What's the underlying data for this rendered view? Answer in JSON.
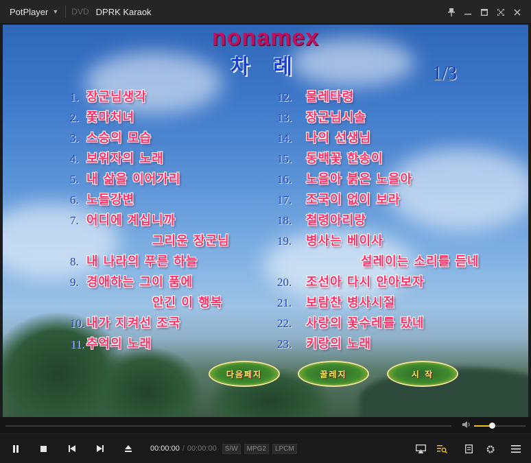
{
  "app": {
    "name": "PotPlayer",
    "source": "DVD",
    "window_title": "DPRK Karaok"
  },
  "titlebar": {
    "icons": [
      "pin-icon",
      "minimize-icon",
      "maximize-icon",
      "fullscreen-icon",
      "close-icon"
    ]
  },
  "video": {
    "brand": "nonamex",
    "heading": "차 례",
    "page": "1/3",
    "left_items": [
      {
        "num": "1.",
        "title": "장군님생각"
      },
      {
        "num": "2.",
        "title": "쫓마처녀"
      },
      {
        "num": "3.",
        "title": "스승의 모습"
      },
      {
        "num": "4.",
        "title": "보위자의 노래"
      },
      {
        "num": "5.",
        "title": "내 삶을 이어가리"
      },
      {
        "num": "6.",
        "title": "노들강변"
      },
      {
        "num": "7.",
        "title": "어디에 계십니까"
      },
      {
        "num": "",
        "title": "그리운 장군님"
      },
      {
        "num": "8.",
        "title": "내 나라의 푸른 하늘"
      },
      {
        "num": "9.",
        "title": "경애하는 그이 품에"
      },
      {
        "num": "",
        "title": "안긴 이 행복"
      },
      {
        "num": "10.",
        "title": "내가 지켜선 조국"
      },
      {
        "num": "11.",
        "title": "추억의 노래"
      }
    ],
    "right_items": [
      {
        "num": "12.",
        "title": "물레타령"
      },
      {
        "num": "13.",
        "title": "장군님시솔"
      },
      {
        "num": "14.",
        "title": "나의 선생님"
      },
      {
        "num": "15.",
        "title": "동백꽃 한송이"
      },
      {
        "num": "16.",
        "title": "노을아 붉은 노을아"
      },
      {
        "num": "17.",
        "title": "조국이 없이 보라"
      },
      {
        "num": "18.",
        "title": "철령아리랑"
      },
      {
        "num": "19.",
        "title": "병사는 베이사"
      },
      {
        "num": "",
        "title": "설레이는 소리를 듣네"
      },
      {
        "num": "20.",
        "title": "조선아 다시 안아보자"
      },
      {
        "num": "21.",
        "title": "보람찬 병사시절"
      },
      {
        "num": "22.",
        "title": "사랑의 꽃수레를 탔네"
      },
      {
        "num": "23.",
        "title": "키랑의 노래"
      }
    ],
    "menu_buttons": [
      "다음페지",
      "꿀레지",
      "시 작"
    ]
  },
  "seekbar": {
    "progress": 0,
    "volume": 0.35,
    "accent": "#f0c020"
  },
  "controls": {
    "current_time": "00:00:00",
    "total_time": "00:00:00",
    "tags": [
      "S/W",
      "MPG2",
      "LPCM"
    ],
    "left_icons": [
      "pause-icon",
      "stop-icon",
      "previous-icon",
      "next-icon",
      "eject-icon"
    ],
    "right_icons": [
      "screen-cast-icon",
      "playlist-search-icon",
      "document-icon",
      "settings-gear-icon",
      "menu-icon"
    ]
  }
}
